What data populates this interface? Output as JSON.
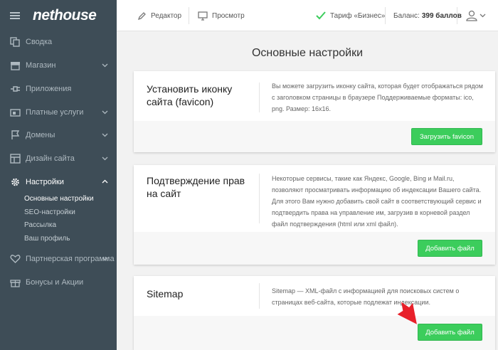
{
  "brand": {
    "logo_text": "nethouse"
  },
  "sidebar": {
    "items": [
      {
        "label": "Сводка",
        "icon": "copy-icon"
      },
      {
        "label": "Магазин",
        "icon": "store-icon",
        "expandable": true
      },
      {
        "label": "Приложения",
        "icon": "plug-icon"
      },
      {
        "label": "Платные услуги",
        "icon": "wallet-icon",
        "expandable": true
      },
      {
        "label": "Домены",
        "icon": "flag-icon",
        "expandable": true
      },
      {
        "label": "Дизайн сайта",
        "icon": "layout-icon",
        "expandable": true
      },
      {
        "label": "Настройки",
        "icon": "gear-icon",
        "expandable": true,
        "expanded": true
      },
      {
        "label": "Партнерская программа",
        "icon": "heart-icon",
        "expandable": true
      },
      {
        "label": "Бонусы и Акции",
        "icon": "gift-icon"
      }
    ],
    "settings_sub": [
      "Основные настройки",
      "SEO-настройки",
      "Рассылка",
      "Ваш профиль"
    ]
  },
  "topbar": {
    "editor": "Редактор",
    "preview": "Просмотр",
    "tariff": "Тариф «Бизнес»",
    "balance_label": "Баланс:",
    "balance_value": "399 баллов"
  },
  "main": {
    "title": "Основные настройки",
    "cards": [
      {
        "title": "Установить иконку сайта (favicon)",
        "description": "Вы можете загрузить иконку сайта, которая будет отображаться рядом с заголовком страницы в браузере Поддерживаемые форматы: ico, png. Размер: 16x16.",
        "button": "Загрузить favicon"
      },
      {
        "title": "Подтверждение прав на сайт",
        "description": "Некоторые сервисы, такие как Яндекс, Google, Bing и Mail.ru, позволяют просматривать информацию об индексации Вашего сайта. Для этого Вам нужно добавить свой сайт в соответствующий сервис и подтвердить права на управление им, загрузив в корневой раздел файл подтверждения (html или xml файл).",
        "button": "Добавить файл"
      },
      {
        "title": "Sitemap",
        "description": "Sitemap — XML-файл с информацией для поисковых систем о страницах веб-сайта, которые подлежат индексации.",
        "button": "Добавить файл"
      }
    ]
  },
  "colors": {
    "sidebar_bg": "#3e4d57",
    "accent_green": "#3ccd5c",
    "arrow_red": "#e8202a"
  }
}
